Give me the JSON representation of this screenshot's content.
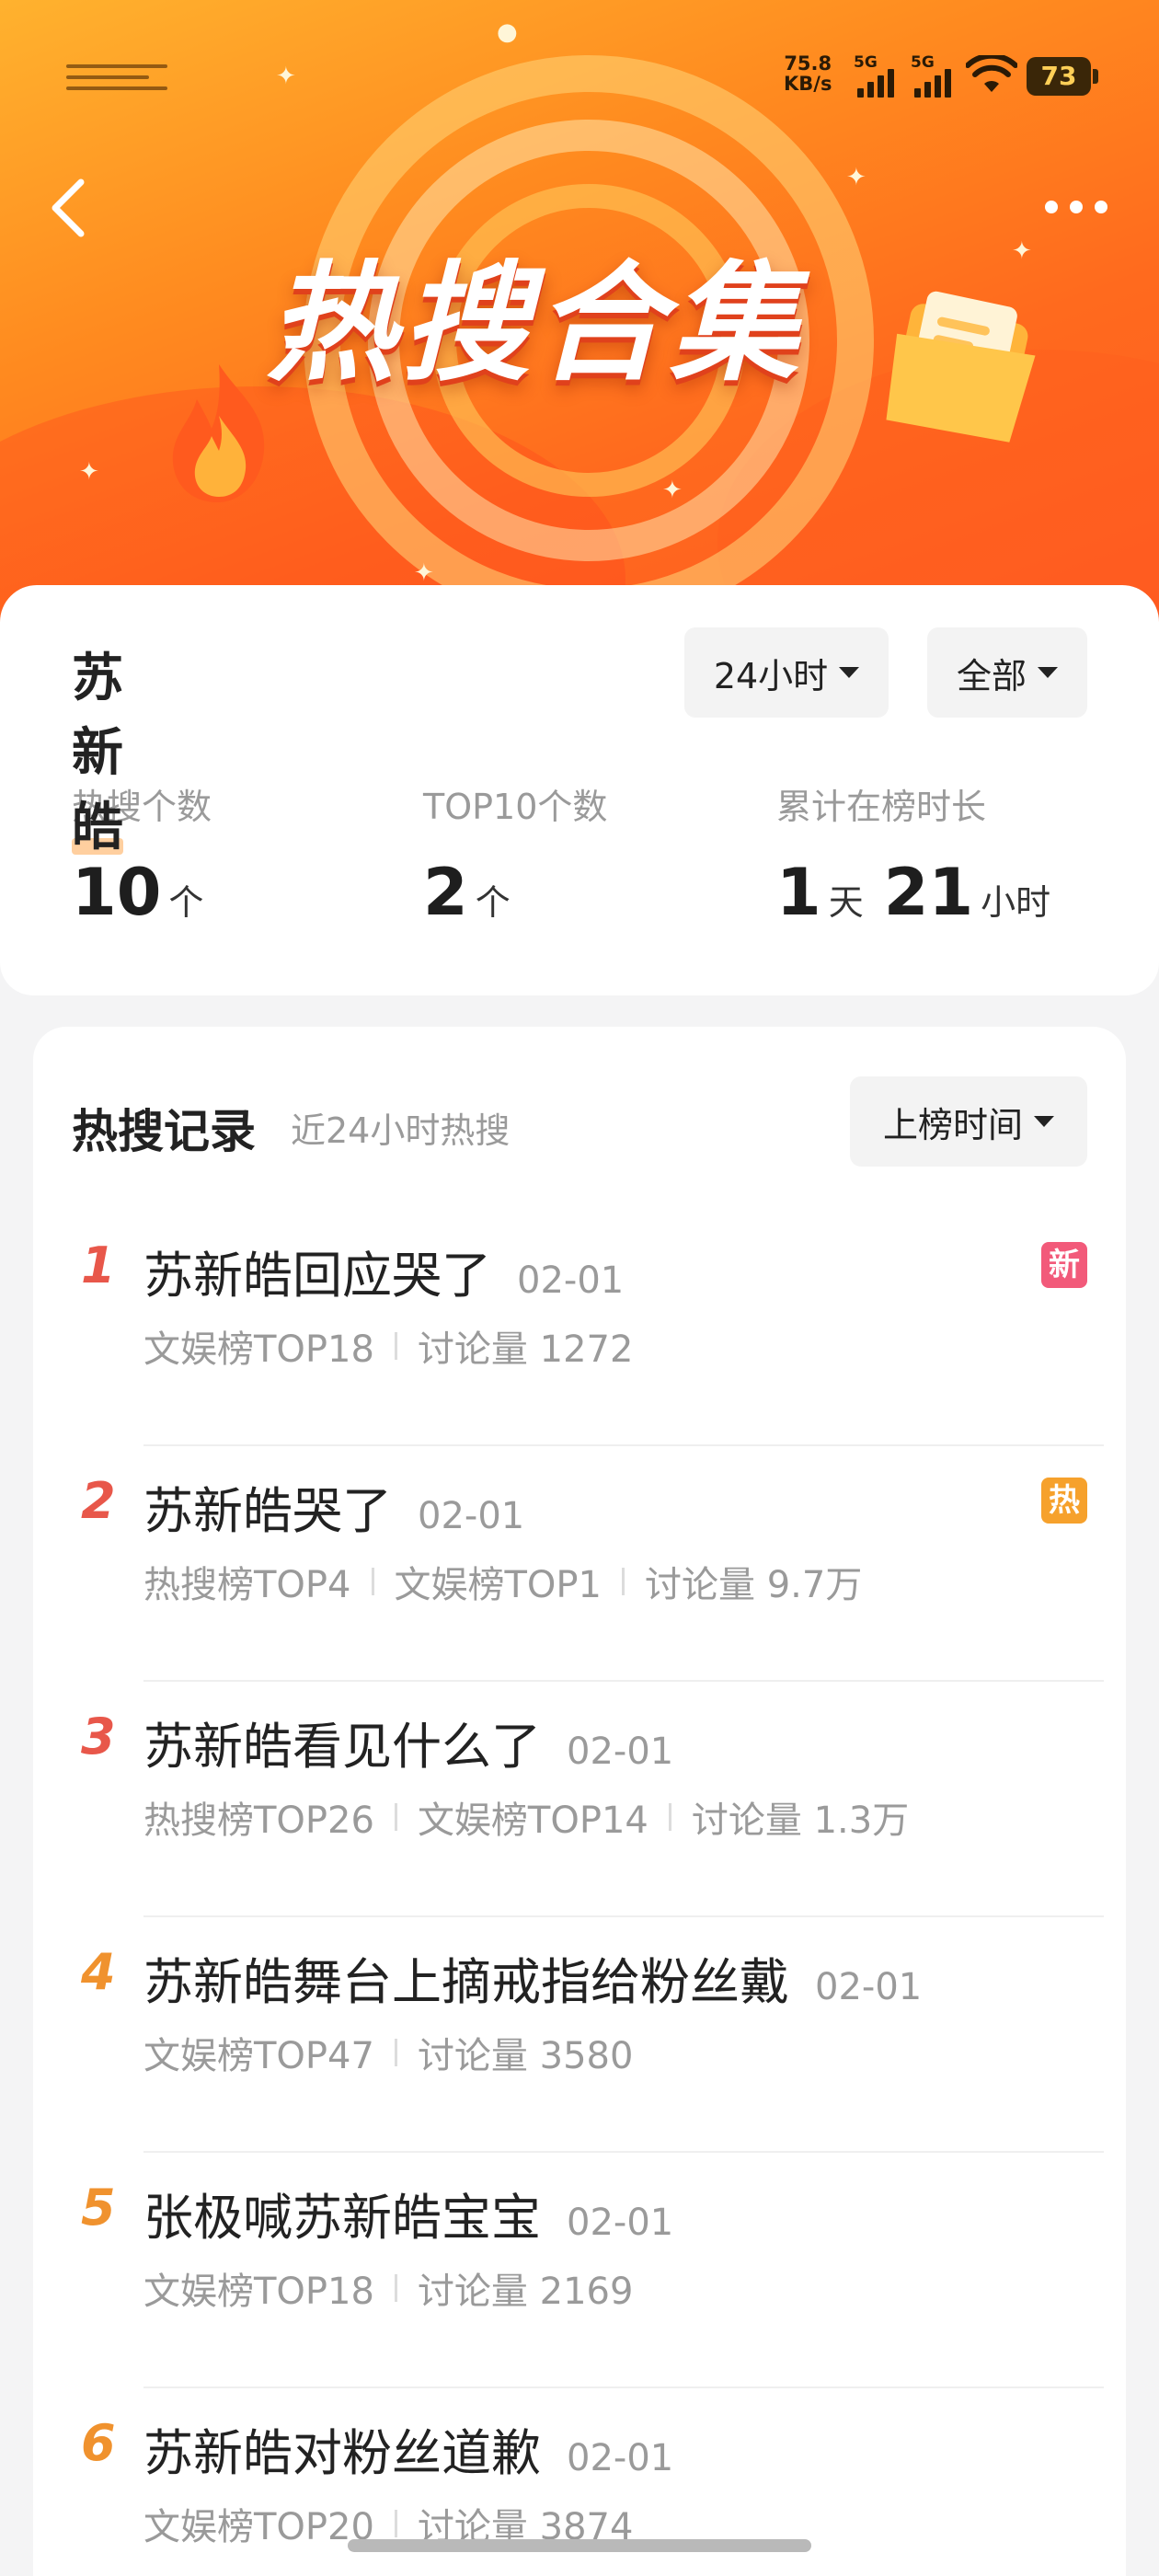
{
  "status_bar": {
    "net_speed_value": "75.8",
    "net_speed_unit": "KB/s",
    "signal_1_label": "5G",
    "signal_2_label": "5G",
    "battery": "73"
  },
  "hero": {
    "title": "热搜合集"
  },
  "summary": {
    "name": "苏新皓",
    "time_filter": "24小时",
    "scope_filter": "全部",
    "stats": [
      {
        "label": "热搜个数",
        "num1": "10",
        "unit1": "个"
      },
      {
        "label": "TOP10个数",
        "num1": "2",
        "unit1": "个"
      },
      {
        "label": "累计在榜时长",
        "num1": "1",
        "unit1": "天",
        "num2": "21",
        "unit2": "小时"
      }
    ]
  },
  "records": {
    "title": "热搜记录",
    "subtitle": "近24小时热搜",
    "sort_label": "上榜时间",
    "items": [
      {
        "rank": "1",
        "title": "苏新皓回应哭了",
        "date": "02-01",
        "meta": [
          "文娱榜TOP18",
          "讨论量 1272"
        ],
        "badge": "新"
      },
      {
        "rank": "2",
        "title": "苏新皓哭了",
        "date": "02-01",
        "meta": [
          "热搜榜TOP4",
          "文娱榜TOP1",
          "讨论量 9.7万"
        ],
        "badge": "热"
      },
      {
        "rank": "3",
        "title": "苏新皓看见什么了",
        "date": "02-01",
        "meta": [
          "热搜榜TOP26",
          "文娱榜TOP14",
          "讨论量 1.3万"
        ]
      },
      {
        "rank": "4",
        "title": "苏新皓舞台上摘戒指给粉丝戴",
        "date": "02-01",
        "meta": [
          "文娱榜TOP47",
          "讨论量 3580"
        ]
      },
      {
        "rank": "5",
        "title": "张极喊苏新皓宝宝",
        "date": "02-01",
        "meta": [
          "文娱榜TOP18",
          "讨论量 2169"
        ]
      },
      {
        "rank": "6",
        "title": "苏新皓对粉丝道歉",
        "date": "02-01",
        "meta": [
          "文娱榜TOP20",
          "讨论量 3874"
        ]
      }
    ]
  },
  "colors": {
    "rank_top3": "#e8574a",
    "rank_other": "#f0922e",
    "badge_new": "#f25a7a",
    "badge_hot": "#f6a12c"
  }
}
